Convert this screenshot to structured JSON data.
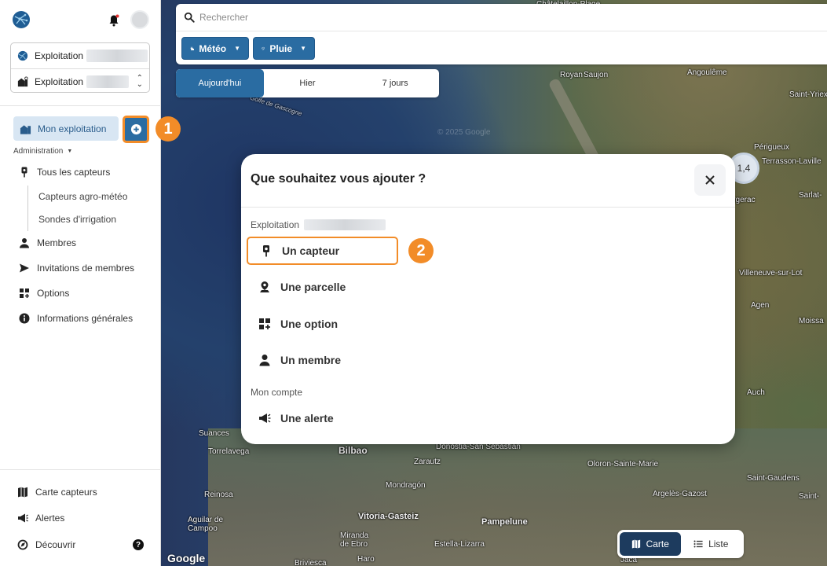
{
  "search": {
    "placeholder": "Rechercher"
  },
  "filters": [
    {
      "label": "Météo"
    },
    {
      "label": "Pluie"
    }
  ],
  "day_tabs": [
    "Aujourd'hui",
    "Hier",
    "7 jours"
  ],
  "sidebar": {
    "org_label": "Exploitation",
    "site_label": "Exploitation",
    "active_item": "Mon exploitation",
    "admin_label": "Administration",
    "items": [
      {
        "label": "Tous les capteurs",
        "icon": "pin-icon"
      },
      {
        "label": "Membres",
        "icon": "person-icon"
      },
      {
        "label": "Invitations de membres",
        "icon": "send-icon"
      },
      {
        "label": "Options",
        "icon": "grid-plus-icon"
      },
      {
        "label": "Informations générales",
        "icon": "info-icon"
      }
    ],
    "sub_items": [
      "Capteurs agro-météo",
      "Sondes d'irrigation"
    ],
    "bottom": [
      {
        "label": "Carte capteurs",
        "icon": "map-icon"
      },
      {
        "label": "Alertes",
        "icon": "megaphone-icon"
      },
      {
        "label": "Découvrir",
        "icon": "compass-icon"
      }
    ],
    "help": "?"
  },
  "steps": {
    "one": "1",
    "two": "2"
  },
  "modal": {
    "title": "Que souhaitez vous ajouter ?",
    "section_exploitation": "Exploitation",
    "section_account": "Mon compte",
    "options": [
      "Un capteur",
      "Une parcelle",
      "Une option",
      "Un membre"
    ],
    "account_options": [
      "Une alerte"
    ]
  },
  "map": {
    "cluster": "1,4",
    "places": [
      "Châtelaillon-Plage",
      "Royan",
      "Saujon",
      "Angoulême",
      "Saint-Yriex",
      "Périgueux",
      "Terrasson-Laville",
      "Sarlat-",
      "Villeneuve-sur-Lot",
      "Agen",
      "Moissa",
      "Auch",
      "Suances",
      "Torrelavega",
      "Bilbao",
      "Donostia-San Sebastián",
      "Zarautz",
      "Mondragón",
      "Oloron-Sainte-Marie",
      "Saint-Gaudens",
      "Argelès-Gazost",
      "Saint-",
      "Reinosa",
      "Aguilar de Campoo",
      "Vitoria-Gasteiz",
      "Pampelune",
      "Miranda de Ebro",
      "Estella-Lizarra",
      "Briviesca",
      "Haro",
      "Jaca",
      "Bergerac"
    ],
    "sea_label": "Golfe de Gascogne",
    "copyright": "© 2025 Google",
    "attribution": "Google"
  },
  "view_toggle": {
    "map": "Carte",
    "list": "Liste"
  }
}
